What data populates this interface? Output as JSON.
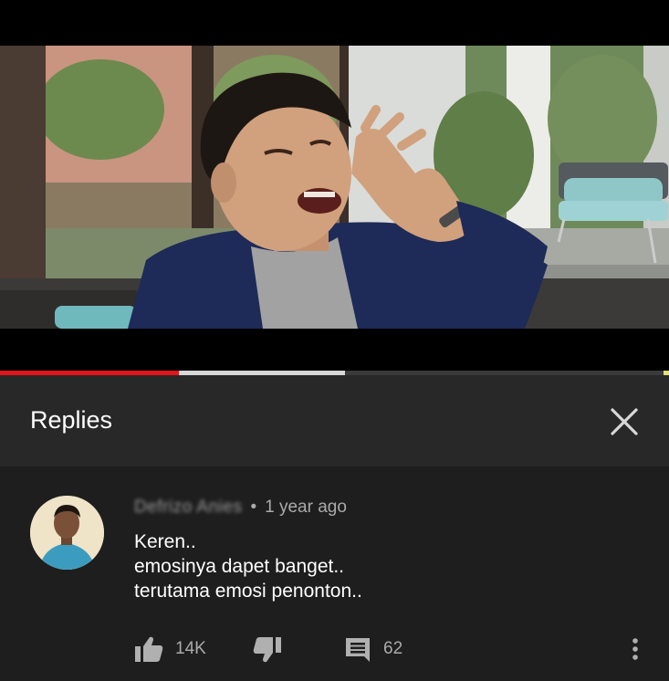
{
  "progress": {
    "played_fraction": 0.268,
    "buffered_fraction": 0.516
  },
  "replies_panel": {
    "title": "Replies",
    "close_icon": "close-icon"
  },
  "comment": {
    "author": "Defrizo Anies",
    "separator": "•",
    "time": "1 year ago",
    "lines": [
      "Keren..",
      "emosinya dapet banget..",
      "terutama emosi penonton.."
    ],
    "likes": "14K",
    "replies": "62"
  },
  "icons": {
    "like": "thumbs-up-icon",
    "dislike": "thumbs-down-icon",
    "reply": "reply-comment-icon",
    "more": "more-vertical-icon"
  },
  "colors": {
    "progress_played": "#e4141b",
    "header_bg": "#282828",
    "comment_bg": "#1e1e1e",
    "secondary_text": "#aaaaaa"
  }
}
